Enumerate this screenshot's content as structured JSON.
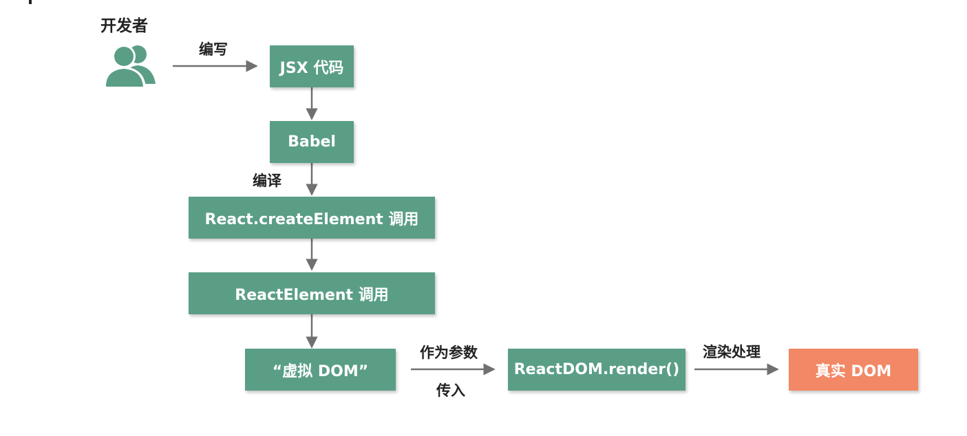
{
  "developer": {
    "label": "开发者",
    "icon": "users-icon"
  },
  "edges": {
    "write": "编写",
    "compile": "编译",
    "as_param": "作为参数",
    "pass_in": "传入",
    "render_process": "渲染处理"
  },
  "nodes": {
    "jsx": "JSX 代码",
    "babel": "Babel",
    "create_element": "React.createElement 调用",
    "react_element": "ReactElement 调用",
    "virtual_dom": "“虚拟 DOM”",
    "render": "ReactDOM.render()",
    "real_dom": "真实 DOM"
  },
  "colors": {
    "node": "#5a9e86",
    "real_dom": "#f28865",
    "arrow": "#707070"
  }
}
